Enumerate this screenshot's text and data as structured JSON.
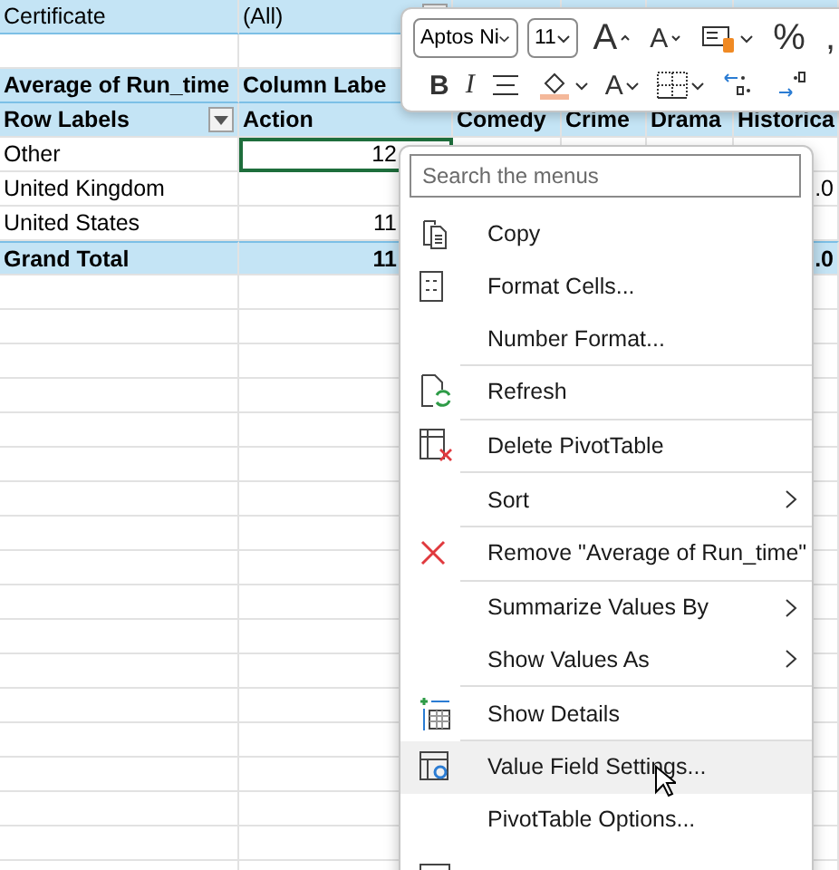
{
  "sheet": {
    "rows": [
      {
        "kind": "filter",
        "cells": [
          {
            "text": "Certificate",
            "selected": false,
            "dropdown": false
          },
          {
            "text": "(All)",
            "selected": false,
            "dropdown": true
          },
          null,
          null,
          null,
          null
        ]
      },
      {
        "kind": "blank",
        "cells": [
          null,
          null,
          null,
          null,
          null,
          null
        ]
      },
      {
        "kind": "header",
        "cells": [
          {
            "text": "Average of Run_time",
            "selected": false,
            "dropdown": false
          },
          {
            "text": "Column Labe",
            "selected": false,
            "dropdown": false
          },
          null,
          null,
          null,
          null
        ]
      },
      {
        "kind": "header",
        "cells": [
          {
            "text": "Row Labels",
            "selected": false,
            "dropdown": true
          },
          {
            "text": "Action",
            "selected": false,
            "dropdown": false
          },
          {
            "text": "Comedy",
            "selected": false,
            "dropdown": false
          },
          {
            "text": "Crime",
            "selected": false,
            "dropdown": false
          },
          {
            "text": "Drama",
            "selected": false,
            "dropdown": false
          },
          {
            "text": "Historica",
            "selected": false,
            "dropdown": false
          }
        ]
      },
      {
        "kind": "data",
        "cells": [
          {
            "text": "Other",
            "selected": false,
            "dropdown": false
          },
          {
            "text": "12",
            "selected": true,
            "dropdown": false
          },
          null,
          null,
          null,
          null
        ]
      },
      {
        "kind": "data",
        "cells": [
          {
            "text": "United Kingdom",
            "selected": false,
            "dropdown": false
          },
          null,
          null,
          null,
          null,
          {
            "text": ".0",
            "selected": false,
            "dropdown": false
          }
        ]
      },
      {
        "kind": "data",
        "cells": [
          {
            "text": "United States",
            "selected": false,
            "dropdown": false
          },
          {
            "text": "11",
            "selected": false,
            "dropdown": false
          },
          null,
          null,
          null,
          null
        ]
      },
      {
        "kind": "total",
        "cells": [
          {
            "text": "Grand Total",
            "selected": false,
            "dropdown": false
          },
          {
            "text": "11",
            "selected": false,
            "dropdown": false
          },
          null,
          null,
          null,
          {
            "text": ".0",
            "selected": false,
            "dropdown": false
          }
        ]
      }
    ]
  },
  "mini_toolbar": {
    "font_name": "Aptos Ni",
    "font_size": "11",
    "row_1": [
      {
        "kind": "grow",
        "label": "A",
        "caret": false
      },
      {
        "kind": "shrink",
        "label": "A",
        "caret": false
      },
      {
        "kind": "format",
        "caret": true
      },
      {
        "kind": "text",
        "label": "%",
        "caret": false
      },
      {
        "kind": "text",
        "label": ",",
        "caret": false
      }
    ],
    "row_2": [
      {
        "kind": "bold",
        "label": "B",
        "caret": false
      },
      {
        "kind": "italic",
        "label": "I",
        "caret": false
      },
      {
        "kind": "align",
        "caret": false
      },
      {
        "kind": "fill",
        "caret": true
      },
      {
        "kind": "font-color",
        "label": "A",
        "caret": true
      },
      {
        "kind": "borders",
        "caret": true
      },
      {
        "kind": "decimals-up",
        "caret": false
      },
      {
        "kind": "decimals-down",
        "caret": false
      }
    ]
  },
  "context_menu": {
    "search": {
      "placeholder": "Search the menus"
    },
    "items": [
      {
        "kind": "copy",
        "label": "Copy",
        "submenu": false,
        "hovered": false
      },
      {
        "kind": "format",
        "label": "Format Cells...",
        "submenu": false,
        "hovered": false
      },
      {
        "kind": "plain",
        "label": "Number Format...",
        "submenu": false,
        "hovered": false
      },
      {
        "kind": "separator"
      },
      {
        "kind": "refresh",
        "label": "Refresh",
        "submenu": false,
        "hovered": false
      },
      {
        "kind": "separator"
      },
      {
        "kind": "delete",
        "label": "Delete PivotTable",
        "submenu": false,
        "hovered": false
      },
      {
        "kind": "separator"
      },
      {
        "kind": "plain",
        "label": "Sort",
        "submenu": true,
        "hovered": false
      },
      {
        "kind": "separator"
      },
      {
        "kind": "remove",
        "label": "Remove \"Average of Run_time\"",
        "submenu": false,
        "hovered": false
      },
      {
        "kind": "separator"
      },
      {
        "kind": "plain",
        "label": "Summarize Values By",
        "submenu": true,
        "hovered": false
      },
      {
        "kind": "plain",
        "label": "Show Values As",
        "submenu": true,
        "hovered": false
      },
      {
        "kind": "separator"
      },
      {
        "kind": "details",
        "label": "Show Details",
        "submenu": false,
        "hovered": false
      },
      {
        "kind": "separator"
      },
      {
        "kind": "settings",
        "label": "Value Field Settings...",
        "submenu": false,
        "hovered": true
      },
      {
        "kind": "plain",
        "label": "PivotTable Options...",
        "submenu": false,
        "hovered": false
      },
      {
        "kind": "table",
        "submenu": false,
        "hovered": false
      }
    ]
  }
}
